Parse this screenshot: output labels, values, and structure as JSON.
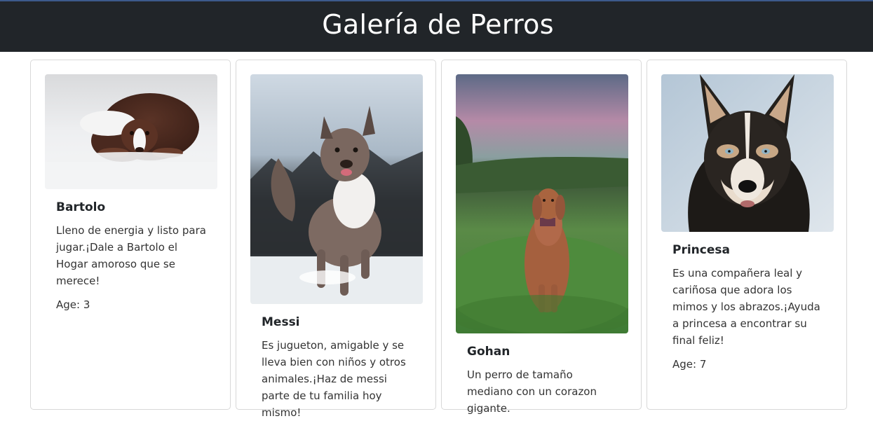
{
  "header": {
    "title": "Galería de Perros"
  },
  "colors": {
    "header_bg": "#212529",
    "header_text": "#ffffff",
    "card_border": "#d8d8d8"
  },
  "cards": [
    {
      "name": "Bartolo",
      "description": "Lleno de energia y listo para jugar.¡Dale a Bartolo el Hogar amoroso que se merece!",
      "age_label": "Age: 3",
      "image": "dog-in-snow-lying-photo"
    },
    {
      "name": "Messi",
      "description": "Es jugueton, amigable y se lleva bien con niños y otros animales.¡Haz de messi parte de tu familia hoy mismo!",
      "age_label": "",
      "image": "dog-running-in-snow-photo"
    },
    {
      "name": "Gohan",
      "description": "Un perro de tamaño mediano con un corazon gigante.",
      "age_label": "",
      "image": "dog-sitting-in-grass-photo"
    },
    {
      "name": "Princesa",
      "description": "Es una compañera leal y cariñosa que adora los mimos y los abrazos.¡Ayuda a princesa a encontrar su final feliz!",
      "age_label": "Age: 7",
      "image": "husky-portrait-photo"
    }
  ]
}
